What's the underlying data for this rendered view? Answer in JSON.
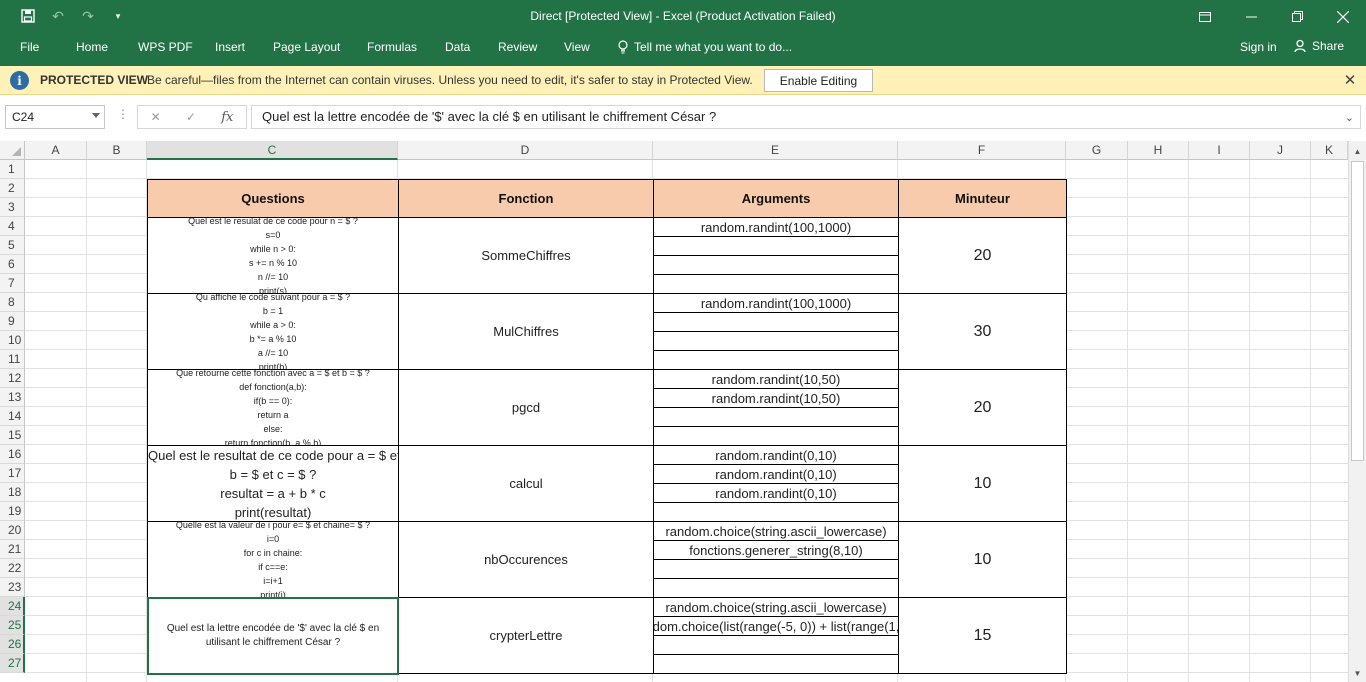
{
  "window": {
    "title": "Direct  [Protected View] - Excel (Product Activation Failed)"
  },
  "ribbon": {
    "tabs": [
      "File",
      "Home",
      "WPS PDF",
      "Insert",
      "Page Layout",
      "Formulas",
      "Data",
      "Review",
      "View"
    ],
    "tell_me": "Tell me what you want to do...",
    "sign_in": "Sign in",
    "share": "Share"
  },
  "protected_view": {
    "label": "PROTECTED VIEW",
    "message": "Be careful—files from the Internet can contain viruses. Unless you need to edit, it's safer to stay in Protected View.",
    "enable_button": "Enable Editing"
  },
  "formula_bar": {
    "name_box": "C24",
    "fx": "fx",
    "content": "Quel est la lettre encodée de '$' avec la clé $ en utilisant le chiffrement César ?"
  },
  "sheet": {
    "columns": [
      "A",
      "B",
      "C",
      "D",
      "E",
      "F",
      "G",
      "H",
      "I",
      "J",
      "K"
    ],
    "selected_column": "C",
    "rows": [
      "1",
      "2",
      "3",
      "4",
      "5",
      "6",
      "7",
      "8",
      "9",
      "10",
      "11",
      "12",
      "13",
      "14",
      "15",
      "16",
      "17",
      "18",
      "19",
      "20",
      "21",
      "22",
      "23",
      "24",
      "25",
      "26",
      "27"
    ],
    "selected_rows": [
      "24",
      "25",
      "26",
      "27"
    ],
    "header": {
      "questions": "Questions",
      "fonction": "Fonction",
      "arguments": "Arguments",
      "minuteur": "Minuteur"
    },
    "records": [
      {
        "question": [
          "Quel est le resulat de ce code pour n = $ ?",
          "s=0",
          "while n > 0:",
          "s += n % 10",
          "n //= 10",
          "print(s)"
        ],
        "fonction": "SommeChiffres",
        "arguments": [
          "random.randint(100,1000)",
          "",
          "",
          ""
        ],
        "minuteur": "20"
      },
      {
        "question": [
          "Qu affiche le code suivant pour a = $ ?",
          "b = 1",
          "while a > 0:",
          "b *= a % 10",
          "a //= 10",
          "print(b)"
        ],
        "fonction": "MulChiffres",
        "arguments": [
          "random.randint(100,1000)",
          "",
          "",
          ""
        ],
        "minuteur": "30"
      },
      {
        "question": [
          "Que retourne cette fonction avec a = $ et b = $ ?",
          "def fonction(a,b):",
          "if(b == 0):",
          "return a",
          "else:",
          "return fonction(b, a % b)"
        ],
        "fonction": "pgcd",
        "arguments": [
          "random.randint(10,50)",
          "random.randint(10,50)",
          "",
          ""
        ],
        "minuteur": "20"
      },
      {
        "question": [
          "Quel est le resultat de ce code pour a = $ et",
          "b = $ et c = $ ?",
          "resultat = a + b * c",
          "print(resultat)"
        ],
        "fonction": "calcul",
        "arguments": [
          "random.randint(0,10)",
          "random.randint(0,10)",
          "random.randint(0,10)",
          ""
        ],
        "minuteur": "10"
      },
      {
        "question": [
          "Quelle est la valeur de i pour e= $ et chaine= $ ?",
          "i=0",
          "for c in chaine:",
          "if c==e:",
          "i=i+1",
          "print(i)"
        ],
        "fonction": "nbOccurences",
        "arguments": [
          "random.choice(string.ascii_lowercase)",
          "fonctions.generer_string(8,10)",
          "",
          ""
        ],
        "minuteur": "10"
      },
      {
        "question": [
          "Quel est la lettre encodée de '$' avec la clé $ en",
          "utilisant le chiffrement César ?"
        ],
        "fonction": "crypterLettre",
        "arguments": [
          "random.choice(string.ascii_lowercase)",
          "dom.choice(list(range(-5, 0)) + list(range(1,",
          "",
          ""
        ],
        "minuteur": "15"
      }
    ]
  }
}
